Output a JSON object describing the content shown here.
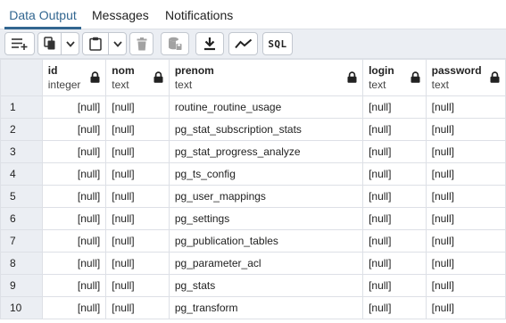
{
  "tabs": {
    "data_output": "Data Output",
    "messages": "Messages",
    "notifications": "Notifications"
  },
  "toolbar": {
    "sql_label": "SQL",
    "buttons": [
      "add-row-icon",
      "copy-icon",
      "chevron-down-icon",
      "paste-icon",
      "chevron-down-icon",
      "trash-icon",
      "save-data-icon",
      "download-icon",
      "graph-icon",
      "sql-icon"
    ]
  },
  "columns": [
    {
      "name": "id",
      "type": "integer"
    },
    {
      "name": "nom",
      "type": "text"
    },
    {
      "name": "prenom",
      "type": "text"
    },
    {
      "name": "login",
      "type": "text"
    },
    {
      "name": "password",
      "type": "text"
    }
  ],
  "rows": [
    {
      "num": "1",
      "id": "[null]",
      "nom": "[null]",
      "prenom": "routine_routine_usage",
      "login": "[null]",
      "password": "[null]"
    },
    {
      "num": "2",
      "id": "[null]",
      "nom": "[null]",
      "prenom": "pg_stat_subscription_stats",
      "login": "[null]",
      "password": "[null]"
    },
    {
      "num": "3",
      "id": "[null]",
      "nom": "[null]",
      "prenom": "pg_stat_progress_analyze",
      "login": "[null]",
      "password": "[null]"
    },
    {
      "num": "4",
      "id": "[null]",
      "nom": "[null]",
      "prenom": "pg_ts_config",
      "login": "[null]",
      "password": "[null]"
    },
    {
      "num": "5",
      "id": "[null]",
      "nom": "[null]",
      "prenom": "pg_user_mappings",
      "login": "[null]",
      "password": "[null]"
    },
    {
      "num": "6",
      "id": "[null]",
      "nom": "[null]",
      "prenom": "pg_settings",
      "login": "[null]",
      "password": "[null]"
    },
    {
      "num": "7",
      "id": "[null]",
      "nom": "[null]",
      "prenom": "pg_publication_tables",
      "login": "[null]",
      "password": "[null]"
    },
    {
      "num": "8",
      "id": "[null]",
      "nom": "[null]",
      "prenom": "pg_parameter_acl",
      "login": "[null]",
      "password": "[null]"
    },
    {
      "num": "9",
      "id": "[null]",
      "nom": "[null]",
      "prenom": "pg_stats",
      "login": "[null]",
      "password": "[null]"
    },
    {
      "num": "10",
      "id": "[null]",
      "nom": "[null]",
      "prenom": "pg_transform",
      "login": "[null]",
      "password": "[null]"
    }
  ],
  "colors": {
    "accent": "#326690",
    "toolbar_bg": "#ebeef3",
    "grid_border": "#dde0e6"
  }
}
